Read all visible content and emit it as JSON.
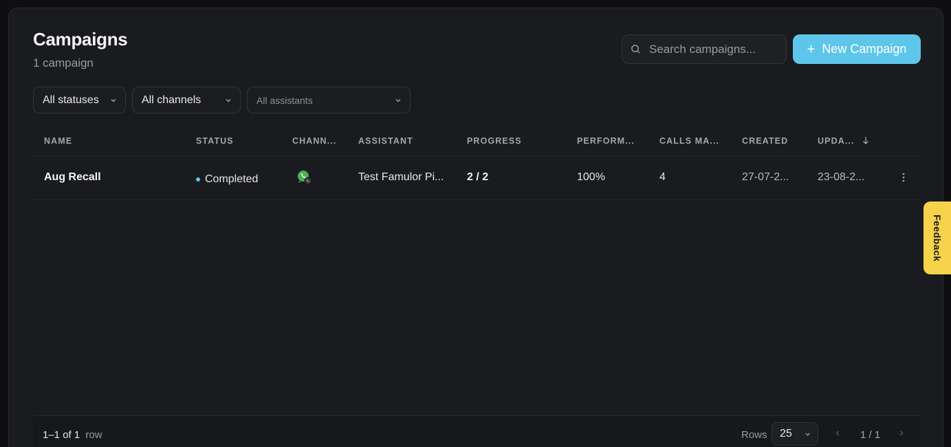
{
  "header": {
    "title": "Campaigns",
    "subtitle": "1 campaign",
    "search_placeholder": "Search campaigns...",
    "new_button_label": "New Campaign"
  },
  "filters": {
    "status": "All statuses",
    "channel": "All channels",
    "assistant": "All assistants"
  },
  "table": {
    "columns": [
      "NAME",
      "STATUS",
      "CHANN...",
      "ASSISTANT",
      "PROGRESS",
      "PERFORM...",
      "CALLS MA...",
      "CREATED",
      "UPDA..."
    ],
    "rows": [
      {
        "name": "Aug Recall",
        "status": "Completed",
        "channel_icon": "whatsapp-call-icon",
        "assistant": "Test Famulor Pi...",
        "progress": "2 / 2",
        "performance": "100%",
        "calls_made": "4",
        "created": "27-07-2...",
        "updated": "23-08-2..."
      }
    ]
  },
  "footer": {
    "range": "1–1 of",
    "total": "1",
    "unit": "row",
    "rows_label": "Rows",
    "rows_per_page": "25",
    "page": "1 / 1"
  },
  "feedback_label": "Feedback",
  "colors": {
    "accent": "#5ec6ea",
    "feedback": "#f6d34a",
    "background": "#1a1b1f",
    "whatsapp": "#4cae59"
  }
}
